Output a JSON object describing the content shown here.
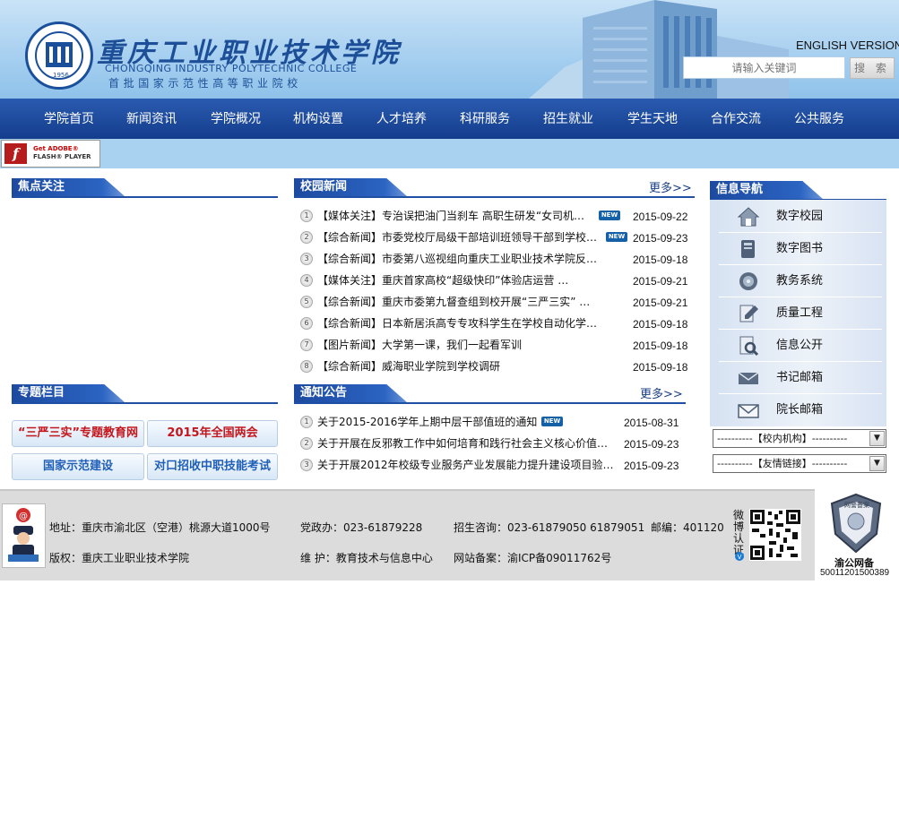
{
  "header": {
    "college_name_cn": "重庆工业职业技术学院",
    "college_name_en": "CHONGQING INDUSTRY POLYTECHNIC COLLEGE",
    "college_tagline": "首批国家示范性高等职业院校",
    "seal_year": "1956",
    "english_version": "ENGLISH VERSION",
    "search_placeholder": "请输入关键词",
    "search_button": "搜 索"
  },
  "nav": [
    "学院首页",
    "新闻资讯",
    "学院概况",
    "机构设置",
    "人才培养",
    "科研服务",
    "招生就业",
    "学生天地",
    "合作交流",
    "公共服务"
  ],
  "flash": {
    "line1": "Get ",
    "adobe": "ADOBE®",
    "line2": "FLASH® PLAYER"
  },
  "focus": {
    "title": "焦点关注"
  },
  "special": {
    "title": "专题栏目",
    "buttons": [
      "“三严三实”专题教育网",
      "2015年全国两会",
      "国家示范建设",
      "对口招收中职技能考试"
    ]
  },
  "campus_news": {
    "title": "校园新闻",
    "more": "更多>>",
    "items": [
      {
        "num": "1",
        "text": "【媒体关注】专治误把油门当刹车 高职生研发“女司机…",
        "new": "NEW",
        "date": "2015-09-22"
      },
      {
        "num": "2",
        "text": "【综合新闻】市委党校厅局级干部培训班领导干部到学校…",
        "new": "NEW",
        "date": "2015-09-23"
      },
      {
        "num": "3",
        "text": "【综合新闻】市委第八巡视组向重庆工业职业技术学院反…",
        "date": "2015-09-18"
      },
      {
        "num": "4",
        "text": "【媒体关注】重庆首家高校“超级快印”体验店运营 …",
        "date": "2015-09-21"
      },
      {
        "num": "5",
        "text": "【综合新闻】重庆市委第九督查组到校开展“三严三实” …",
        "date": "2015-09-21"
      },
      {
        "num": "6",
        "text": "【综合新闻】日本新居浜高专专攻科学生在学校自动化学…",
        "date": "2015-09-18"
      },
      {
        "num": "7",
        "text": "【图片新闻】大学第一课，我们一起看军训",
        "date": "2015-09-18"
      },
      {
        "num": "8",
        "text": "【综合新闻】威海职业学院到学校调研",
        "date": "2015-09-18"
      }
    ]
  },
  "notices": {
    "title": "通知公告",
    "more": "更多>>",
    "items": [
      {
        "num": "1",
        "text": "关于2015-2016学年上期中层干部值班的通知",
        "new": "NEW",
        "date": "2015-08-31"
      },
      {
        "num": "2",
        "text": "关于开展在反邪教工作中如何培育和践行社会主义核心价值…",
        "date": "2015-09-23"
      },
      {
        "num": "3",
        "text": "关于开展2012年校级专业服务产业发展能力提升建设项目验…",
        "date": "2015-09-23"
      }
    ]
  },
  "info_nav": {
    "title": "信息导航",
    "items": [
      {
        "label": "数字校园",
        "icon": "home-icon"
      },
      {
        "label": "数字图书",
        "icon": "book-icon"
      },
      {
        "label": "教务系统",
        "icon": "disc-icon"
      },
      {
        "label": "质量工程",
        "icon": "pencil-doc-icon"
      },
      {
        "label": "信息公开",
        "icon": "search-doc-icon"
      },
      {
        "label": "书记邮箱",
        "icon": "envelope-icon"
      },
      {
        "label": "院长邮箱",
        "icon": "envelope-open-icon"
      }
    ],
    "select1": "----------【校内机构】----------",
    "select2": "----------【友情链接】----------"
  },
  "footer": {
    "address": "地址：重庆市渝北区（空港）桃源大道1000号",
    "party_office": "党政办：023-61879228",
    "admission": "招生咨询：023-61879050 61879051",
    "postcode": "邮编：401120",
    "copyright": "版权：重庆工业职业技术学院",
    "maintainer": "维  护：教育技术与信息中心",
    "icp": "网站备案：渝ICP备09011762号",
    "weibo": "微博认证",
    "badge_title": "网警备案",
    "badge_label": "渝公网备",
    "badge_number": "50011201500389"
  },
  "colors": {
    "nav_dark": "#143d8c",
    "nav_light": "#2a5bb0",
    "accent": "#1f4fa3",
    "header_bg": "#a8d0f0"
  }
}
